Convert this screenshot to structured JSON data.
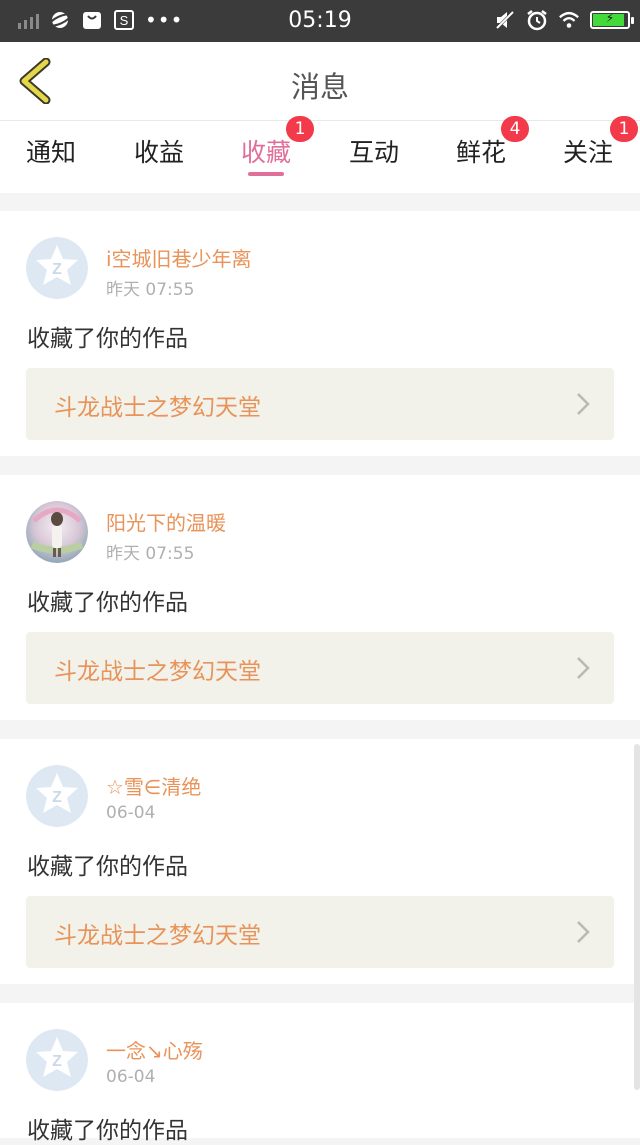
{
  "status_bar": {
    "time": "05:19",
    "dots": "•••",
    "battery_level": 0.9,
    "icons": [
      "signal-icon",
      "planet-icon",
      "bag-icon",
      "s-app-icon",
      "mute-icon",
      "alarm-icon",
      "wifi-icon",
      "battery-icon"
    ]
  },
  "header": {
    "title": "消息",
    "back_icon": "chevron-left-icon"
  },
  "tabs": [
    {
      "label": "通知",
      "badge": ""
    },
    {
      "label": "收益",
      "badge": ""
    },
    {
      "label": "收藏",
      "badge": "1",
      "active": true
    },
    {
      "label": "互动",
      "badge": ""
    },
    {
      "label": "鲜花",
      "badge": "4"
    },
    {
      "label": "关注",
      "badge": "1"
    }
  ],
  "messages": [
    {
      "user": "i空城旧巷少年离",
      "time": "昨天 07:55",
      "action": "收藏了你的作品",
      "work": "斗龙战士之梦幻天堂",
      "avatar": "default-avatar"
    },
    {
      "user": "阳光下的温暖",
      "time": "昨天 07:55",
      "action": "收藏了你的作品",
      "work": "斗龙战士之梦幻天堂",
      "avatar": "photo-avatar"
    },
    {
      "user": "☆雪∈清绝",
      "time": "06-04",
      "action": "收藏了你的作品",
      "work": "斗龙战士之梦幻天堂",
      "avatar": "default-avatar"
    },
    {
      "user": "一念↘心殇",
      "time": "06-04",
      "action": "收藏了你的作品",
      "work": "",
      "avatar": "default-avatar"
    }
  ],
  "colors": {
    "accent": "#e0709a",
    "username": "#e8935a",
    "badge": "#f23a4a",
    "work_bg": "#f2f2ea"
  }
}
